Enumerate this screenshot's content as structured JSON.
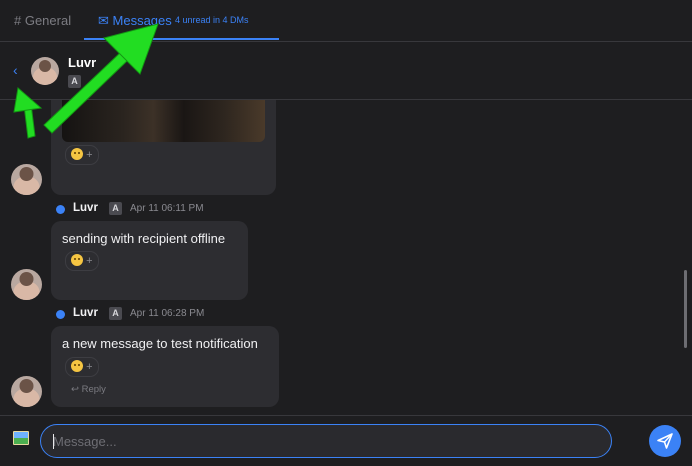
{
  "tabs": {
    "general_label": "# General",
    "messages_label": "✉ Messages",
    "unread_summary": "4 unread in 4 DMs"
  },
  "conversation": {
    "back_label": "‹",
    "name": "Luvr",
    "badge": "A"
  },
  "messages": [
    {
      "type": "image",
      "reaction_add": "+"
    },
    {
      "sender": "Luvr",
      "badge": "A",
      "timestamp": "Apr 11 06:11 PM",
      "text": "sending with recipient offline",
      "reaction_add": "+"
    },
    {
      "sender": "Luvr",
      "badge": "A",
      "timestamp": "Apr 11 06:28 PM",
      "text": "a new message to test notification",
      "reaction_add": "+",
      "reply_label": "↩ Reply"
    }
  ],
  "composer": {
    "placeholder": "Message...",
    "value": ""
  },
  "icons": {
    "image": "image-icon",
    "send": "send-icon",
    "emoji": "smiley-icon"
  },
  "colors": {
    "accent": "#3b82f6",
    "background": "#1e1e20",
    "bubble": "#2d2d31",
    "annotation_arrow": "#22dd22"
  }
}
